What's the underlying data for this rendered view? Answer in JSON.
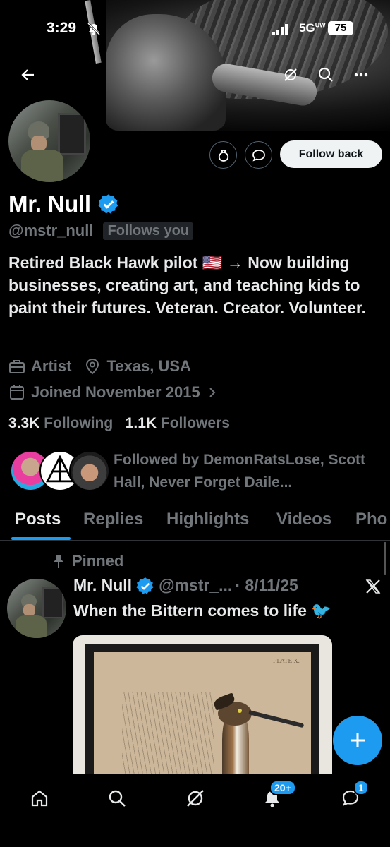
{
  "status_bar": {
    "time": "3:29",
    "network": "5G",
    "network_suffix": "UW",
    "battery": "75"
  },
  "profile": {
    "name": "Mr. Null",
    "handle": "@mstr_null",
    "follows_you": "Follows you",
    "bio": "Retired Black Hawk pilot 🇺🇸 → Now building businesses, creating art, and teaching kids to paint their futures. Veteran. Creator. Volunteer.",
    "category": "Artist",
    "location": "Texas, USA",
    "joined": "Joined November 2015",
    "following_count": "3.3K",
    "following_label": "Following",
    "followers_count": "1.1K",
    "followers_label": "Followers",
    "followed_by": "Followed by DemonRatsLose, Scott Hall, Never Forget Daile..."
  },
  "actions": {
    "follow_back": "Follow back"
  },
  "tabs": [
    {
      "label": "Posts",
      "active": true
    },
    {
      "label": "Replies",
      "active": false
    },
    {
      "label": "Highlights",
      "active": false
    },
    {
      "label": "Videos",
      "active": false
    },
    {
      "label": "Pho",
      "active": false
    }
  ],
  "post": {
    "pinned_label": "Pinned",
    "author": "Mr. Null",
    "handle": "@mstr_...",
    "date": "· 8/11/25",
    "text": "When the Bittern comes to life 🐦",
    "image_plate_text": "PLATE X."
  },
  "bottom_nav": {
    "items": [
      "home-icon",
      "search-icon",
      "grok-icon",
      "notifications-icon",
      "messages-icon"
    ],
    "notifications_badge": "20+",
    "messages_badge": "1"
  },
  "colors": {
    "accent": "#1d9bf0",
    "background": "#000000",
    "muted": "#71767b",
    "text": "#e7e9ea"
  }
}
